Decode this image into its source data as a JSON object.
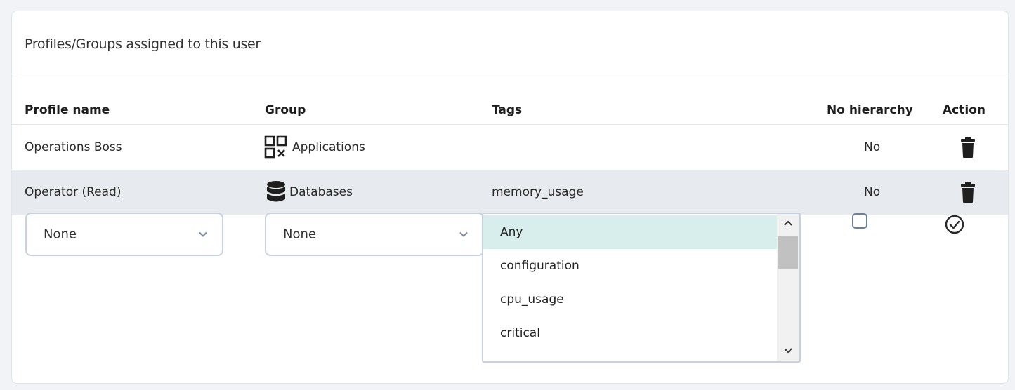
{
  "panel": {
    "title": "Profiles/Groups assigned to this user"
  },
  "table": {
    "headers": {
      "profile": "Profile name",
      "group": "Group",
      "tags": "Tags",
      "no_hierarchy": "No hierarchy",
      "action": "Action"
    },
    "rows": [
      {
        "profile": "Operations Boss",
        "group": "Applications",
        "group_icon": "applications-icon",
        "tags": "",
        "no_hierarchy": "No",
        "action_icon": "trash-icon"
      },
      {
        "profile": "Operator (Read)",
        "group": "Databases",
        "group_icon": "database-icon",
        "tags": "memory_usage",
        "no_hierarchy": "No",
        "action_icon": "trash-icon"
      }
    ]
  },
  "new_row": {
    "profile_select": {
      "value": "None"
    },
    "group_select": {
      "value": "None"
    },
    "tags_list": {
      "options": [
        "Any",
        "configuration",
        "cpu_usage",
        "critical"
      ],
      "selected": "Any"
    },
    "no_hierarchy_checked": false,
    "confirm_icon": "check-circle-icon"
  },
  "colors": {
    "selected_option": "#d8eeec",
    "alt_row": "#e7eaee",
    "border": "#c8d2de"
  }
}
